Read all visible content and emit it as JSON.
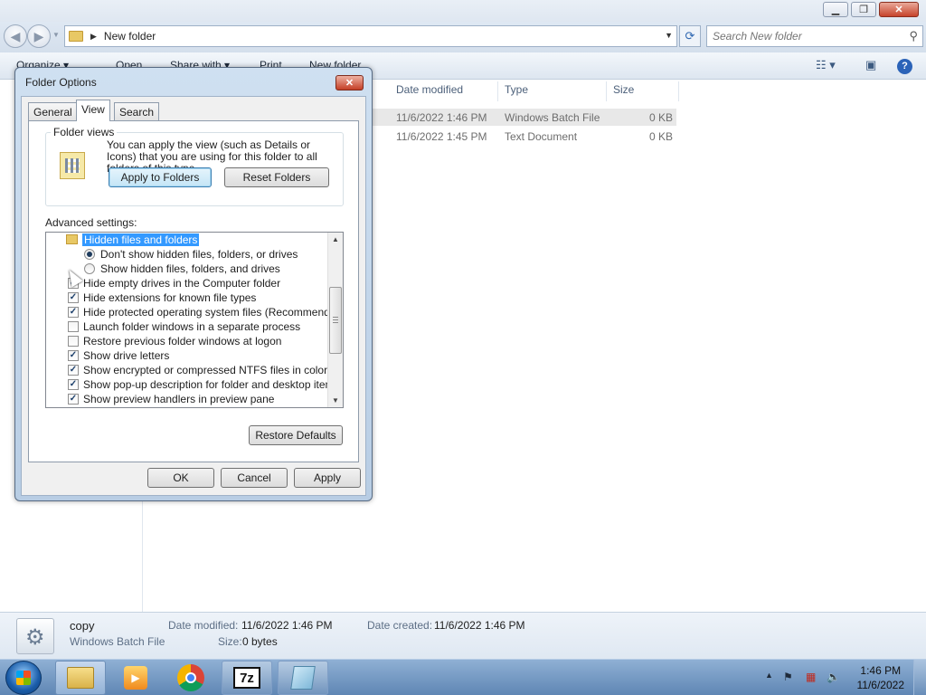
{
  "explorer": {
    "address": {
      "crumb": "New folder"
    },
    "search": {
      "placeholder": "Search New folder"
    },
    "toolbar": {
      "organize": "Organize ▾",
      "open": "Open",
      "share_with": "Share with ▾",
      "print": "Print",
      "new_folder": "New folder"
    },
    "columns": {
      "date_modified": "Date modified",
      "type": "Type",
      "size": "Size"
    },
    "files": [
      {
        "date": "11/6/2022 1:46 PM",
        "type": "Windows Batch File",
        "size": "0 KB",
        "selected": true
      },
      {
        "date": "11/6/2022 1:45 PM",
        "type": "Text Document",
        "size": "0 KB",
        "selected": false
      }
    ],
    "details": {
      "name": "copy",
      "type": "Windows Batch File",
      "date_modified_label": "Date modified:",
      "date_modified": "11/6/2022 1:46 PM",
      "date_created_label": "Date created:",
      "date_created": "11/6/2022 1:46 PM",
      "size_label": "Size:",
      "size": "0 bytes"
    }
  },
  "dialog": {
    "title": "Folder Options",
    "tabs": [
      "General",
      "View",
      "Search"
    ],
    "active_tab": "View",
    "folder_views": {
      "legend": "Folder views",
      "description": "You can apply the view (such as Details or Icons) that you are using for this folder to all folders of this type.",
      "apply_button": "Apply to Folders",
      "reset_button": "Reset Folders"
    },
    "advanced_label": "Advanced settings:",
    "settings": [
      {
        "kind": "folder",
        "label": "Hidden files and folders",
        "highlighted": true
      },
      {
        "kind": "radio",
        "label": "Don't show hidden files, folders, or drives",
        "checked": true
      },
      {
        "kind": "radio",
        "label": "Show hidden files, folders, and drives",
        "checked": false
      },
      {
        "kind": "check",
        "label": "Hide empty drives in the Computer folder",
        "checked": true
      },
      {
        "kind": "check",
        "label": "Hide extensions for known file types",
        "checked": true
      },
      {
        "kind": "check",
        "label": "Hide protected operating system files (Recommended)",
        "checked": true
      },
      {
        "kind": "check",
        "label": "Launch folder windows in a separate process",
        "checked": false
      },
      {
        "kind": "check",
        "label": "Restore previous folder windows at logon",
        "checked": false
      },
      {
        "kind": "check",
        "label": "Show drive letters",
        "checked": true
      },
      {
        "kind": "check",
        "label": "Show encrypted or compressed NTFS files in color",
        "checked": true
      },
      {
        "kind": "check",
        "label": "Show pop-up description for folder and desktop items",
        "checked": true
      },
      {
        "kind": "check",
        "label": "Show preview handlers in preview pane",
        "checked": true
      }
    ],
    "restore_defaults": "Restore Defaults",
    "ok": "OK",
    "cancel": "Cancel",
    "apply": "Apply"
  },
  "taskbar": {
    "apps": [
      {
        "icon": "windows-explorer-icon",
        "state": "pressed"
      },
      {
        "icon": "media-player-icon",
        "state": "pinned"
      },
      {
        "icon": "chrome-icon",
        "state": "pinned"
      },
      {
        "icon": "7zip-icon",
        "label": "7z",
        "state": "open"
      },
      {
        "icon": "notepad-icon",
        "state": "open"
      }
    ],
    "time": "1:46 PM",
    "date": "11/6/2022"
  },
  "colors": {
    "selection_blue": "#3399ff",
    "dialog_frame": "#b8cde4",
    "taskbar": "#5f86b4",
    "close_red": "#c43e25"
  }
}
